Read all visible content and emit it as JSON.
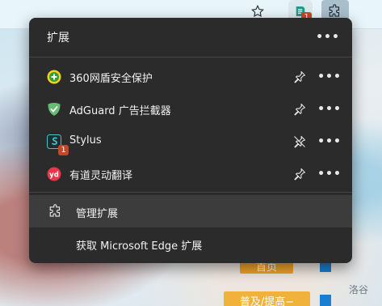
{
  "panel": {
    "title": "扩展",
    "more_glyph": "•••"
  },
  "extensions": [
    {
      "name": "360网盾安全保护",
      "icon": "shield-360-icon",
      "pinned": true,
      "badge": ""
    },
    {
      "name": "AdGuard 广告拦截器",
      "icon": "adguard-icon",
      "pinned": true,
      "badge": ""
    },
    {
      "name": "Stylus",
      "icon": "stylus-icon",
      "pinned": false,
      "badge": "1"
    },
    {
      "name": "有道灵动翻译",
      "icon": "youdao-icon",
      "pinned": true,
      "badge": ""
    }
  ],
  "footer": {
    "manage_label": "管理扩展",
    "get_label": "获取 Microsoft Edge 扩展"
  },
  "toolbar": {
    "extension_badge": "1"
  },
  "background": {
    "tag_1": "首页",
    "tag_2": "普及/提高−",
    "watermark": "洛谷"
  },
  "colors": {
    "panel_bg": "#2b2b2b",
    "hover_bg": "#3c3c3c",
    "badge": "#c0492a",
    "accent_blue": "#1a7fd0"
  }
}
